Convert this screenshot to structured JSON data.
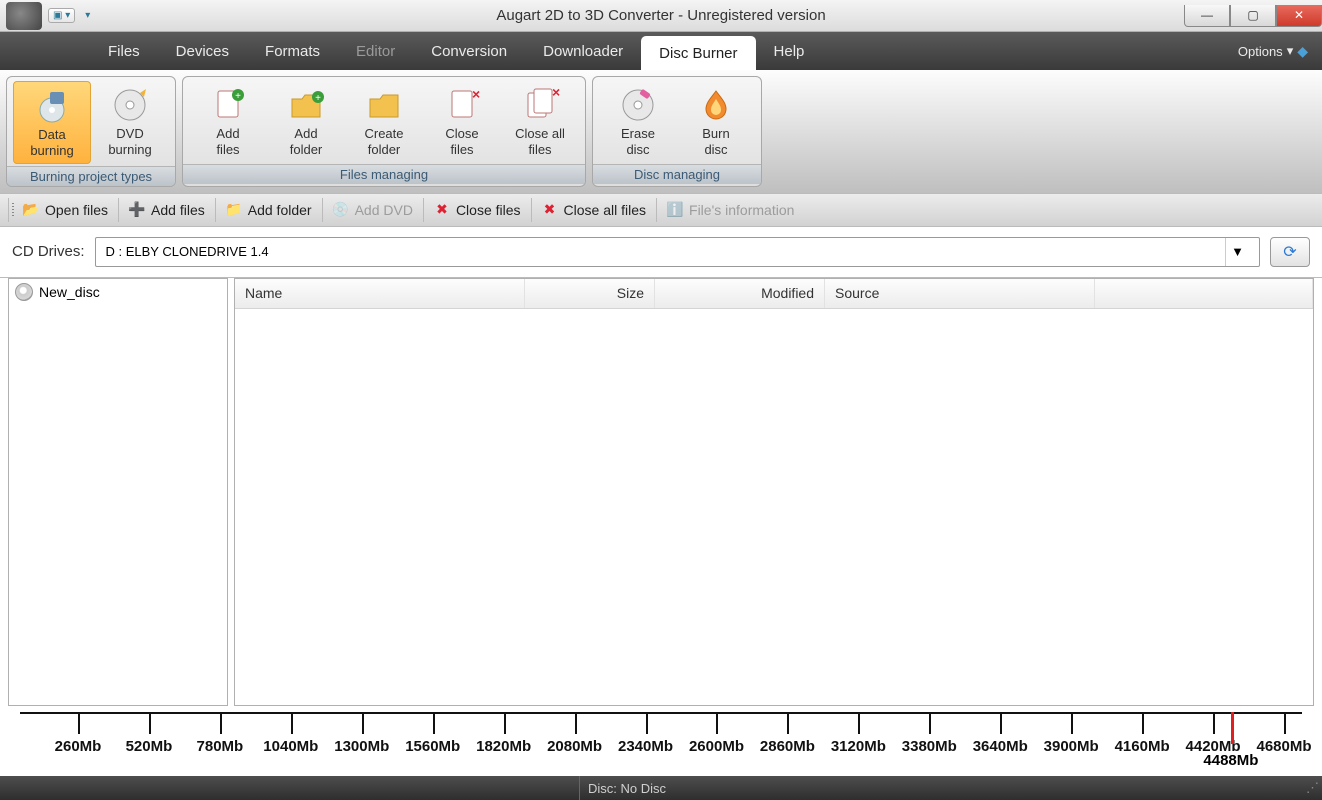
{
  "titlebar": {
    "title": "Augart 2D to 3D Converter - Unregistered version"
  },
  "menu": {
    "files": "Files",
    "devices": "Devices",
    "formats": "Formats",
    "editor": "Editor",
    "conversion": "Conversion",
    "downloader": "Downloader",
    "disc_burner": "Disc Burner",
    "help": "Help",
    "options": "Options"
  },
  "ribbon": {
    "groups": {
      "burning_types": {
        "label": "Burning project types",
        "buttons": {
          "data_burning": {
            "l1": "Data",
            "l2": "burning"
          },
          "dvd_burning": {
            "l1": "DVD",
            "l2": "burning"
          }
        }
      },
      "files_managing": {
        "label": "Files managing",
        "buttons": {
          "add_files": {
            "l1": "Add",
            "l2": "files"
          },
          "add_folder": {
            "l1": "Add",
            "l2": "folder"
          },
          "create_folder": {
            "l1": "Create",
            "l2": "folder"
          },
          "close_files": {
            "l1": "Close",
            "l2": "files"
          },
          "close_all_files": {
            "l1": "Close all",
            "l2": "files"
          }
        }
      },
      "disc_managing": {
        "label": "Disc managing",
        "buttons": {
          "erase_disc": {
            "l1": "Erase",
            "l2": "disc"
          },
          "burn_disc": {
            "l1": "Burn",
            "l2": "disc"
          }
        }
      }
    }
  },
  "toolbar": {
    "open_files": "Open files",
    "add_files": "Add files",
    "add_folder": "Add folder",
    "add_dvd": "Add DVD",
    "close_files": "Close files",
    "close_all_files": "Close all files",
    "files_information": "File's information"
  },
  "drive": {
    "label": "CD Drives:",
    "selected": "D : ELBY    CLONEDRIVE     1.4"
  },
  "tree": {
    "root": "New_disc"
  },
  "columns": {
    "name": "Name",
    "size": "Size",
    "modified": "Modified",
    "source": "Source"
  },
  "ruler": {
    "ticks": [
      "260Mb",
      "520Mb",
      "780Mb",
      "1040Mb",
      "1300Mb",
      "1560Mb",
      "1820Mb",
      "2080Mb",
      "2340Mb",
      "2600Mb",
      "2860Mb",
      "3120Mb",
      "3380Mb",
      "3640Mb",
      "3900Mb",
      "4160Mb",
      "4420Mb",
      "4680Mb"
    ],
    "used_label": "4488Mb",
    "used_fraction": 0.956
  },
  "status": {
    "disc": "Disc: No Disc"
  }
}
